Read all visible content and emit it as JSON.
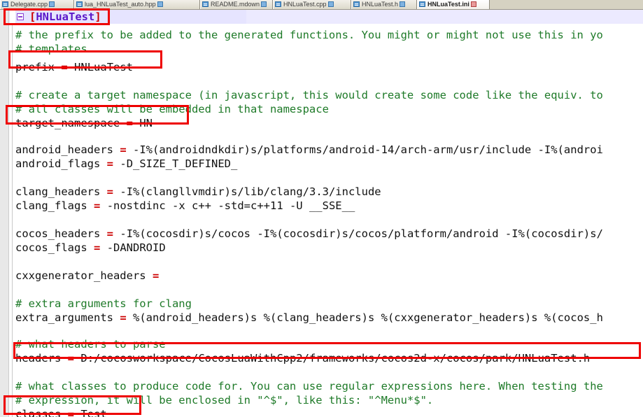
{
  "window": {
    "app": "text-editor",
    "accent_annotation_color": "#ee0000",
    "comment_color": "#1e7a28",
    "operator_color": "#cc0000",
    "section_name_color": "#5a17c8"
  },
  "tabbar": {
    "tabs": [
      {
        "label": "Delegate.cpp",
        "active": false,
        "icon": "document-icon",
        "modified_marker": "saved-icon"
      },
      {
        "label": "lua_HNLuaTest_auto.hpp",
        "active": false,
        "icon": "document-icon",
        "modified_marker": "saved-icon"
      },
      {
        "label": "README.mdown",
        "active": false,
        "icon": "document-icon",
        "modified_marker": "saved-icon"
      },
      {
        "label": "HNLuaTest.cpp",
        "active": false,
        "icon": "document-icon",
        "modified_marker": "saved-icon"
      },
      {
        "label": "HNLuaTest.h",
        "active": false,
        "icon": "document-icon",
        "modified_marker": "saved-icon"
      },
      {
        "label": "HNLuaTest.ini",
        "active": true,
        "icon": "document-icon",
        "modified_marker": "unsaved-icon"
      }
    ]
  },
  "editor": {
    "section_header": {
      "open_bracket": "[",
      "name": "HNLuaTest",
      "close_bracket": "]"
    },
    "lines": [
      {
        "id": "comment-prefix-1",
        "type": "comment",
        "text": "# the prefix to be added to the generated functions. You might or might not use this in yo"
      },
      {
        "id": "comment-prefix-2",
        "type": "comment",
        "text": "# templates"
      },
      {
        "id": "prefix",
        "type": "setting",
        "key": "prefix",
        "eq": "=",
        "value": "HNLuaTest"
      },
      {
        "id": "comment-namespace-1",
        "type": "comment",
        "text": "# create a target namespace (in javascript, this would create some code like the equiv. to"
      },
      {
        "id": "comment-namespace-2",
        "type": "comment",
        "text": "# all classes will be embedded in that namespace"
      },
      {
        "id": "target_namespace",
        "type": "setting",
        "key": "target_namespace",
        "eq": "=",
        "value": "HN"
      },
      {
        "id": "android_headers",
        "type": "setting",
        "key": "android_headers",
        "eq": "=",
        "value": "-I%(androidndkdir)s/platforms/android-14/arch-arm/usr/include -I%(androi"
      },
      {
        "id": "android_flags",
        "type": "setting",
        "key": "android_flags",
        "eq": "=",
        "value": "-D_SIZE_T_DEFINED_"
      },
      {
        "id": "clang_headers",
        "type": "setting",
        "key": "clang_headers",
        "eq": "=",
        "value": "-I%(clangllvmdir)s/lib/clang/3.3/include"
      },
      {
        "id": "clang_flags",
        "type": "setting",
        "key": "clang_flags",
        "eq": "=",
        "value": "-nostdinc -x c++ -std=c++11 -U __SSE__"
      },
      {
        "id": "cocos_headers",
        "type": "setting",
        "key": "cocos_headers",
        "eq": "=",
        "value": "-I%(cocosdir)s/cocos -I%(cocosdir)s/cocos/platform/android -I%(cocosdir)s/"
      },
      {
        "id": "cocos_flags",
        "type": "setting",
        "key": "cocos_flags",
        "eq": "=",
        "value": "-DANDROID"
      },
      {
        "id": "cxxgenerator_headers",
        "type": "setting",
        "key": "cxxgenerator_headers",
        "eq": "=",
        "value": ""
      },
      {
        "id": "comment-extra-args",
        "type": "comment",
        "text": "# extra arguments for clang"
      },
      {
        "id": "extra_arguments",
        "type": "setting",
        "key": "extra_arguments",
        "eq": "=",
        "value": "%(android_headers)s %(clang_headers)s %(cxxgenerator_headers)s %(cocos_h"
      },
      {
        "id": "comment-headers",
        "type": "comment",
        "text": "# what headers to parse"
      },
      {
        "id": "headers",
        "type": "setting",
        "key": "headers",
        "eq": "=",
        "value": "D:/cocosworkspace/CocosLuaWithCpp2/frameworks/cocos2d-x/cocos/park/HNLuaTest.h"
      },
      {
        "id": "comment-classes-1",
        "type": "comment",
        "text": "# what classes to produce code for. You can use regular expressions here. When testing the"
      },
      {
        "id": "comment-classes-2",
        "type": "comment",
        "text": "# expression, it will be enclosed in \"^$\", like this: \"^Menu*$\"."
      },
      {
        "id": "classes",
        "type": "setting",
        "key": "classes",
        "eq": "=",
        "value": "Test"
      }
    ]
  },
  "annotations": [
    {
      "id": "annot-section",
      "target": "section-header"
    },
    {
      "id": "annot-prefix",
      "target": "prefix"
    },
    {
      "id": "annot-target-namespace",
      "target": "target_namespace"
    },
    {
      "id": "annot-headers",
      "target": "headers"
    },
    {
      "id": "annot-classes",
      "target": "classes"
    }
  ]
}
